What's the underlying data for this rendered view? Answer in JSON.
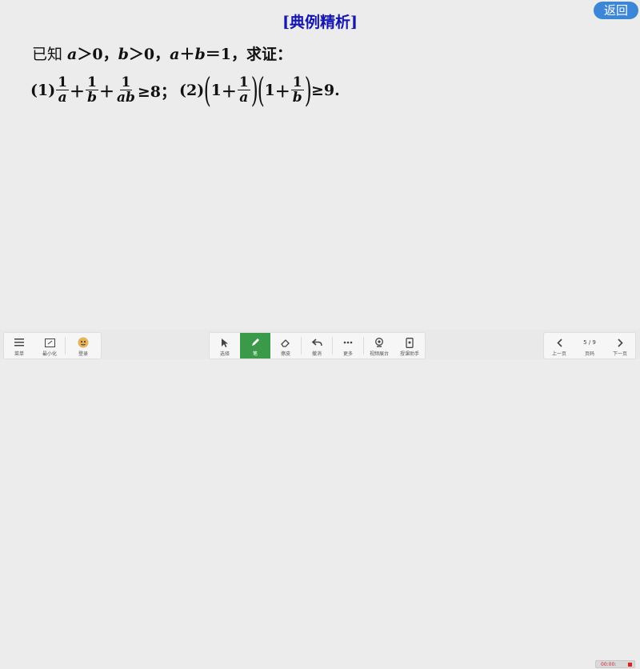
{
  "slide": {
    "title": "[典例精析]",
    "back_label": "返回",
    "problem_prefix": "已知 ",
    "cond_a": "a",
    "cond_a_rel": "＞0，",
    "cond_b": "b",
    "cond_b_rel": "＞0，",
    "cond_sum_a": "a",
    "cond_plus": "＋",
    "cond_sum_b": "b",
    "cond_sum_rel": "＝1，求证：",
    "part1_label": "(1)",
    "part1_num": "1",
    "part1_den_a": "a",
    "part1_den_b": "b",
    "part1_den_ab": "ab",
    "plus": "＋",
    "part1_rel": "≥8；",
    "part2_label": "(2)",
    "one": "1",
    "part2_rel": "≥9."
  },
  "toolbar": {
    "menu": "菜单",
    "minimize": "最小化",
    "login": "登录",
    "select": "选择",
    "pen": "笔",
    "eraser": "擦皮",
    "undo": "撤消",
    "more": "更多",
    "camera": "视频展台",
    "assistant": "授课助手",
    "prev": "上一页",
    "pages": "页码",
    "next": "下一页",
    "page_indicator": "5 / 9",
    "record_time": "00:00:"
  }
}
